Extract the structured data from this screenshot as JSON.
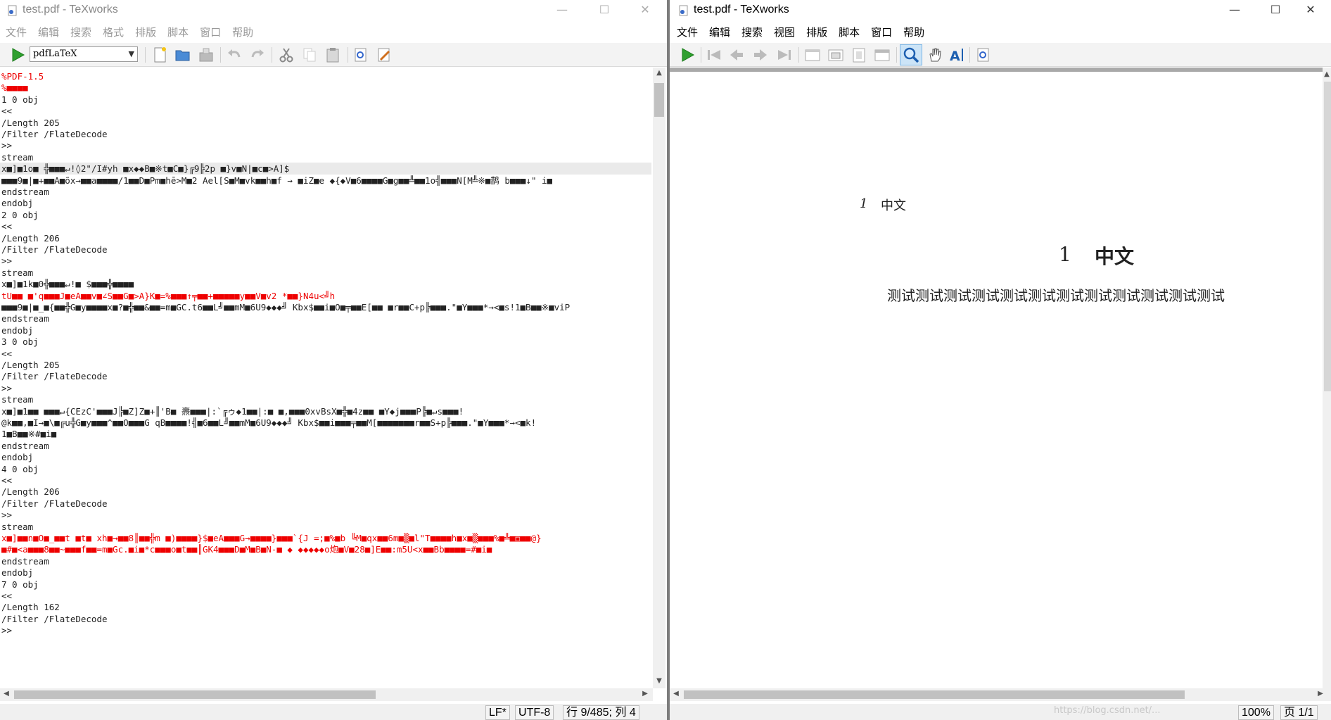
{
  "left": {
    "title": "test.pdf - TeXworks",
    "menu": [
      "文件",
      "编辑",
      "搜索",
      "格式",
      "排版",
      "脚本",
      "窗口",
      "帮助"
    ],
    "engine": "pdfLaTeX",
    "lines": [
      {
        "t": "%PDF-1.5",
        "c": "red"
      },
      {
        "t": "%■■■■",
        "c": "red"
      },
      {
        "t": "1 0 obj",
        "c": ""
      },
      {
        "t": "<<",
        "c": ""
      },
      {
        "t": "/Length 205",
        "c": ""
      },
      {
        "t": "/Filter /FlateDecode",
        "c": ""
      },
      {
        "t": ">>",
        "c": ""
      },
      {
        "t": "stream",
        "c": ""
      },
      {
        "t": "x■]■1o■ ╬■■■↵!◊2\"/I#yh ■x◆◆B■※t■C■}╔9╠2p ■}v■N|■c■>A]$",
        "c": "hl"
      },
      {
        "t": "■■■9■|■+■■A■õx→■■a■■■■/1■■D■Pm■hē>M■2 Ael[S■M■vk■■h■f → ■iZ■e ◆{◆V■6■■■■G■g■■╩■■1o╣■■■N[M╩※■鹊 b■■■↓\" i■",
        "c": ""
      },
      {
        "t": "endstream",
        "c": ""
      },
      {
        "t": "endobj",
        "c": ""
      },
      {
        "t": "2 0 obj",
        "c": ""
      },
      {
        "t": "<<",
        "c": ""
      },
      {
        "t": "/Length 206",
        "c": ""
      },
      {
        "t": "/Filter /FlateDecode",
        "c": ""
      },
      {
        "t": ">>",
        "c": ""
      },
      {
        "t": "stream",
        "c": ""
      },
      {
        "t": "x■]■1k■0╬■■■↵!■ $■■■╬■■■■",
        "c": ""
      },
      {
        "t": "tU■■ ■'q■■■J■eA■■v■∠S■■G■>A}K■=%■■■↑╤■■+■■■■■y■■V■v2 *■■}N4u<╝h",
        "c": "red"
      },
      {
        "t": "■■■9■|■_■{■■╬G■y■■■■x■?■╬■■&■■=m■GC.t6■■L╝■■mM■6U9◆◆◆╝ Kbx$■■i■O■╤■■E[■■ ■r■■C+p╠■■■.\"■Y■■■*→<■s!1■B■■※■viP",
        "c": ""
      },
      {
        "t": "endstream",
        "c": ""
      },
      {
        "t": "endobj",
        "c": ""
      },
      {
        "t": "3 0 obj",
        "c": ""
      },
      {
        "t": "<<",
        "c": ""
      },
      {
        "t": "/Length 205",
        "c": ""
      },
      {
        "t": "/Filter /FlateDecode",
        "c": ""
      },
      {
        "t": ">>",
        "c": ""
      },
      {
        "t": "stream",
        "c": ""
      },
      {
        "t": "x■]■1■■ ■■■↵{CEzC'■■■J╠■Z]Z■+║'B■ 燾■■■|:`╔ゥ◆1■■|:■ ■,■■■0xvBsX■╬■4z■■ ■Y◆j■■■P╠■↵s■■■!",
        "c": ""
      },
      {
        "t": "@k■■,■I→■\\■╔u╬G■y■■■^■■O■■■G qB■■■■!╣■6■■L╝■■mM■6U9◆◆◆╝ Kbx$■■i■■■╤■■M[■■■■■■■r■■S+p╠■■■.\"■Y■■■*→<■k!",
        "c": ""
      },
      {
        "t": "1■B■■※#■i■",
        "c": ""
      },
      {
        "t": "endstream",
        "c": ""
      },
      {
        "t": "endobj",
        "c": ""
      },
      {
        "t": "4 0 obj",
        "c": ""
      },
      {
        "t": "<<",
        "c": ""
      },
      {
        "t": "/Length 206",
        "c": ""
      },
      {
        "t": "/Filter /FlateDecode",
        "c": ""
      },
      {
        "t": ">>",
        "c": ""
      },
      {
        "t": "stream",
        "c": ""
      },
      {
        "t": "x■]■■n■O■_■■t ■t■ xh■→■■8║■■╬m ■)■■■■}$■eA■■■G→■■■■}■■■`{J =;■%■b ╚M■qx■■6m■▒■l\"T■■■■h■x■▒■■■%■╩■▣■■@}",
        "c": "red"
      },
      {
        "t": "■#■<a■■■8■■~■■■f■■=m■Gc.■i■*c■■■o■t■■║GK4■■■D■M■B■N-■ ◆ ◆◆◆◆◆o炮■V■28■]E■■:m5U<x■■Bb■■■■=#■i■",
        "c": "red"
      },
      {
        "t": "endstream",
        "c": ""
      },
      {
        "t": "endobj",
        "c": ""
      },
      {
        "t": "7 0 obj",
        "c": ""
      },
      {
        "t": "<<",
        "c": ""
      },
      {
        "t": "/Length 162",
        "c": ""
      },
      {
        "t": "/Filter /FlateDecode",
        "c": ""
      },
      {
        "t": ">>",
        "c": ""
      }
    ],
    "status": {
      "eol": "LF*",
      "encoding": "UTF-8",
      "position": "行 9/485; 列 4"
    }
  },
  "right": {
    "title": "test.pdf - TeXworks",
    "menu": [
      "文件",
      "编辑",
      "搜索",
      "视图",
      "排版",
      "脚本",
      "窗口",
      "帮助"
    ],
    "pdf": {
      "header_num": "1",
      "header_text": "中文",
      "section_num": "1",
      "section_title": "中文",
      "body": "测试测试测试测试测试测试测试测试测试测试测试测试"
    },
    "status": {
      "zoom": "100%",
      "page": "页 1/1"
    },
    "watermark": "https://blog.csdn.net/..."
  },
  "colors": {
    "accent_green": "#2fa02f",
    "red_text": "#e00000"
  }
}
